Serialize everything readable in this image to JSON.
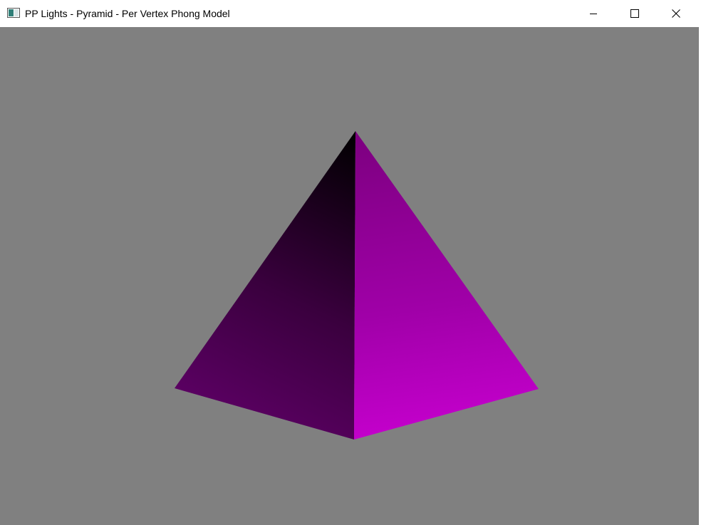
{
  "window": {
    "title": "PP Lights - Pyramid - Per Vertex Phong Model",
    "icon": "app-window-icon",
    "buttons": {
      "minimize_icon": "minimize-icon",
      "maximize_icon": "maximize-icon",
      "close_icon": "close-icon"
    }
  },
  "viewport": {
    "background_color": "#808080",
    "object": "pyramid",
    "left_face_colors": [
      "#000000",
      "#5a0060"
    ],
    "right_face_colors": [
      "#880088",
      "#c000c8"
    ]
  }
}
